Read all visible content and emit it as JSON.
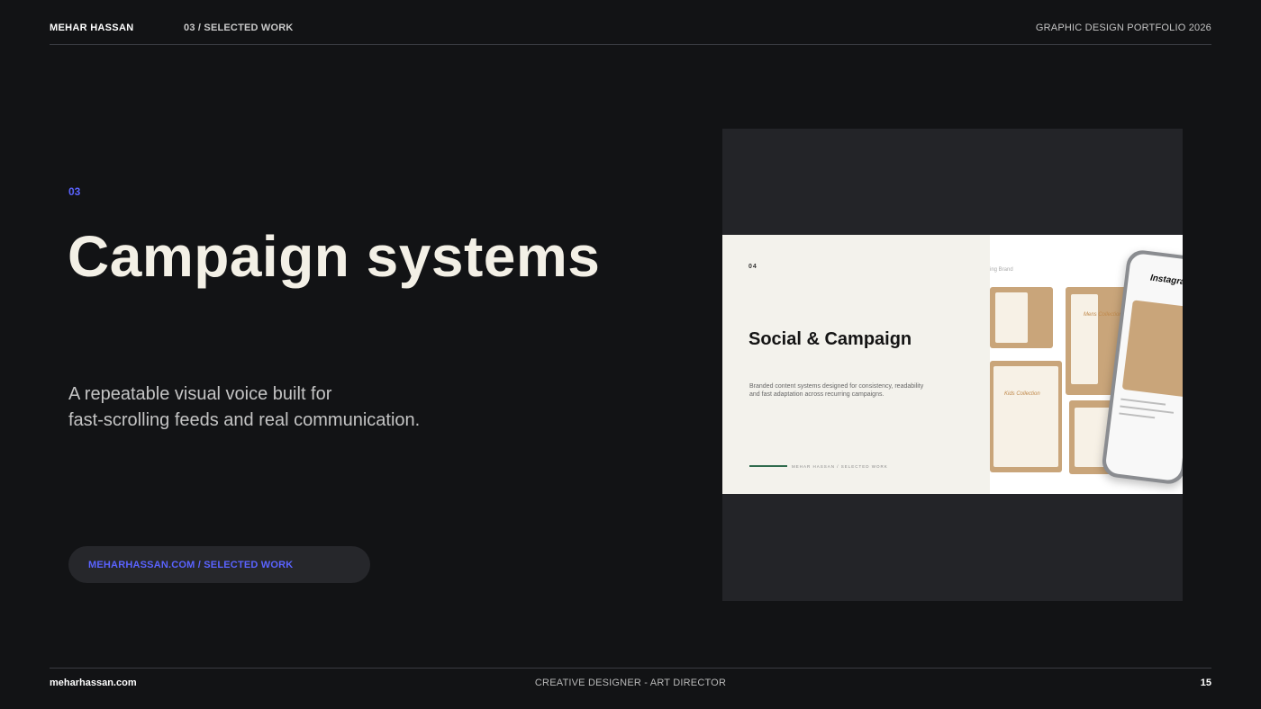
{
  "header": {
    "name": "MEHAR HASSAN",
    "section": "03 / SELECTED WORK",
    "portfolio": "GRAPHIC DESIGN PORTFOLIO 2026"
  },
  "main": {
    "number": "03",
    "title": "Campaign systems",
    "description_lines": [
      "A repeatable visual voice built for",
      "fast-scrolling feeds and real communication."
    ],
    "pill_label": "MEHARHASSAN.COM / SELECTED WORK"
  },
  "preview": {
    "number": "04",
    "title": "Social & Campaign",
    "description_lines": [
      "Branded content systems designed for consistency, readability",
      "and fast adaptation across recurring campaigns."
    ],
    "footer": "MEHAR HASSAN  /  SELECTED WORK",
    "brand_label": "ing Brand",
    "caption_a": "Kids Collection",
    "caption_b": "Mens Collection",
    "instagram": "Instagram"
  },
  "footer": {
    "site": "meharhassan.com",
    "role": "CREATIVE DESIGNER - ART DIRECTOR",
    "page": "15"
  },
  "colors": {
    "accent": "#5a63ff",
    "background": "#121315",
    "frame": "#232428",
    "rule_green": "#2f6b4d"
  }
}
